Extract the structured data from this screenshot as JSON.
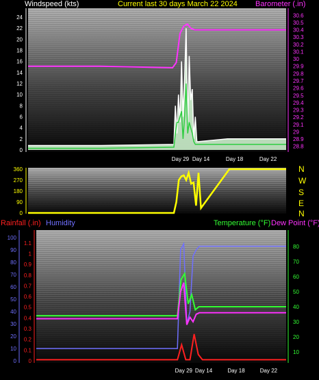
{
  "header": {
    "wind_label": "Windspeed (kts)",
    "title": "Current last 30 days March 22 2024",
    "baro_label": "Barometer (.in)"
  },
  "lower_header": {
    "rain_label": "Rainfall (.in)",
    "humidity_label": "Humidity",
    "temp_label": "Temperature (°F)",
    "dew_label": "Dew Point (°F)"
  },
  "compass": [
    "N",
    "W",
    "S",
    "E",
    "N"
  ],
  "colors": {
    "wind": "#ffffff",
    "wind_gust": "#2ecc40",
    "barometer": "#ff33ff",
    "direction": "#ffff00",
    "rain": "#ff2020",
    "humidity": "#7070ff",
    "temperature": "#33ff33",
    "dew_point": "#ff33ff"
  },
  "chart_data": [
    {
      "type": "line",
      "name": "wind-barometer",
      "x_ticks": [
        "Day 29",
        "Day 14",
        "Day 18",
        "Day 22"
      ],
      "y_left": {
        "label": "Windspeed (kts)",
        "ticks": [
          0,
          2,
          4,
          6,
          8,
          10,
          12,
          14,
          16,
          18,
          20,
          22,
          24
        ],
        "ylim": [
          0,
          25
        ]
      },
      "y_right": {
        "label": "Barometer (.in)",
        "ticks": [
          "28.8",
          "28.9",
          "29",
          "29.1",
          "29.2",
          "29.3",
          "29.4",
          "29.5",
          "29.6",
          "29.7",
          "29.8",
          "29.9",
          "30",
          "30.1",
          "30.2",
          "30.3",
          "30.4",
          "30.5",
          "30.6"
        ],
        "ylim": [
          28.75,
          30.65
        ]
      },
      "series": [
        {
          "values": [
            0.8,
            0.8,
            1.0,
            8,
            3,
            10,
            5,
            16,
            6,
            13,
            22,
            4,
            17,
            9,
            11,
            2,
            6,
            1.5,
            1.5,
            2,
            2
          ]
        },
        {
          "values": [
            0.3,
            0.3,
            0.5,
            3,
            5,
            5,
            6,
            7,
            2,
            6,
            12,
            3,
            5,
            4,
            3,
            1.5,
            1,
            1,
            1,
            1,
            1
          ]
        },
        {
          "values": [
            29.9,
            29.9,
            29.88,
            29.95,
            30.35,
            30.45,
            30.48,
            30.42,
            30.4,
            30.4,
            30.4,
            30.4
          ]
        }
      ]
    },
    {
      "type": "line",
      "name": "wind-direction",
      "x_ticks": [],
      "y_left": {
        "ticks": [
          0,
          90,
          180,
          270,
          360
        ],
        "ylim": [
          0,
          360
        ]
      },
      "series": [
        {
          "values": [
            0,
            0,
            0,
            90,
            270,
            300,
            310,
            270,
            330,
            240,
            250,
            60,
            330,
            40,
            360,
            360
          ]
        }
      ]
    },
    {
      "type": "line",
      "name": "rain-humidity-temperature",
      "x_ticks": [
        "Day 29",
        "Day 14",
        "Day 18",
        "Day 22"
      ],
      "y_left_outer": {
        "label": "Humidity",
        "ticks": [
          0,
          10,
          20,
          30,
          40,
          50,
          60,
          70,
          80,
          90,
          100
        ],
        "ylim": [
          0,
          100
        ]
      },
      "y_left": {
        "label": "Rainfall (.in)",
        "ticks": [
          "0",
          "0.1",
          "0.2",
          "0.3",
          "0.4",
          "0.5",
          "0.6",
          "0.7",
          "0.8",
          "0.9",
          "1",
          "1.1"
        ],
        "ylim": [
          0,
          1.15
        ]
      },
      "y_right": {
        "label": "Temperature (°F)",
        "ticks": [
          10,
          20,
          30,
          40,
          50,
          60,
          70,
          80
        ],
        "ylim": [
          4,
          86
        ]
      },
      "series": [
        {
          "values": [
            0.01,
            0.01,
            0.01,
            0.15,
            0.01,
            0.01,
            0.25,
            0.06,
            0.01,
            0.01,
            0.01
          ]
        },
        {
          "values": [
            10,
            10,
            10,
            90,
            95,
            30,
            40,
            85,
            90,
            93,
            93,
            93,
            93
          ]
        },
        {
          "values": [
            34,
            34,
            34,
            58,
            62,
            42,
            48,
            38,
            40,
            40,
            40,
            40
          ]
        },
        {
          "values": [
            32,
            32,
            32,
            50,
            56,
            28,
            33,
            30,
            35,
            36,
            36,
            36,
            36
          ]
        }
      ]
    }
  ]
}
